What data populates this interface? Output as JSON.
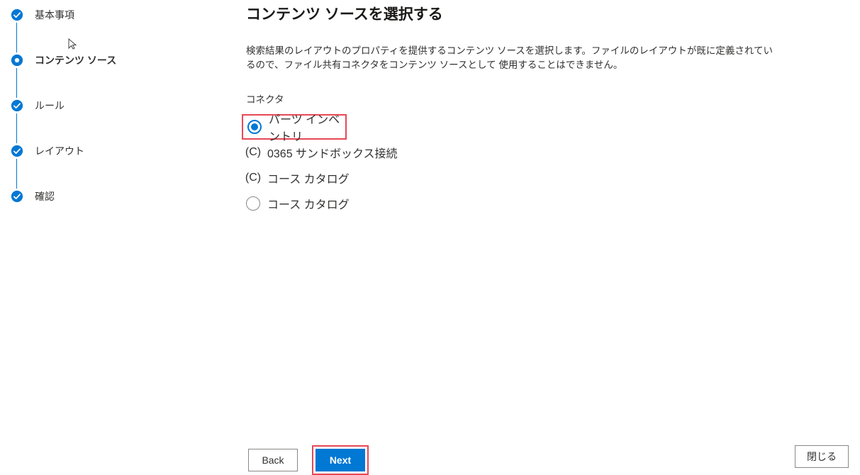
{
  "steps": [
    {
      "label": "基本事項",
      "state": "done"
    },
    {
      "label": "コンテンツ ソース",
      "state": "current"
    },
    {
      "label": "ルール",
      "state": "done"
    },
    {
      "label": "レイアウト",
      "state": "done"
    },
    {
      "label": "確認",
      "state": "done"
    }
  ],
  "page": {
    "title": "コンテンツ ソースを選択する",
    "description": "検索結果のレイアウトのプロパティを提供するコンテンツ ソースを選択します。ファイルのレイアウトが既に定義されているので、ファイル共有コネクタをコンテンツ ソースとして 使用することはできません。",
    "group_label": "コネクタ"
  },
  "options": [
    {
      "label": "パーツ インベントリ",
      "kind": "radio",
      "selected": true,
      "highlight": true
    },
    {
      "label": "0365 サンドボックス接続",
      "kind": "disabled"
    },
    {
      "label": "コース カタログ",
      "kind": "disabled"
    },
    {
      "label": "コース カタログ",
      "kind": "radio",
      "selected": false
    }
  ],
  "footer": {
    "back": "Back",
    "next": "Next",
    "close": "閉じる"
  },
  "colors": {
    "primary": "#0078d4",
    "highlight": "#e74856"
  }
}
